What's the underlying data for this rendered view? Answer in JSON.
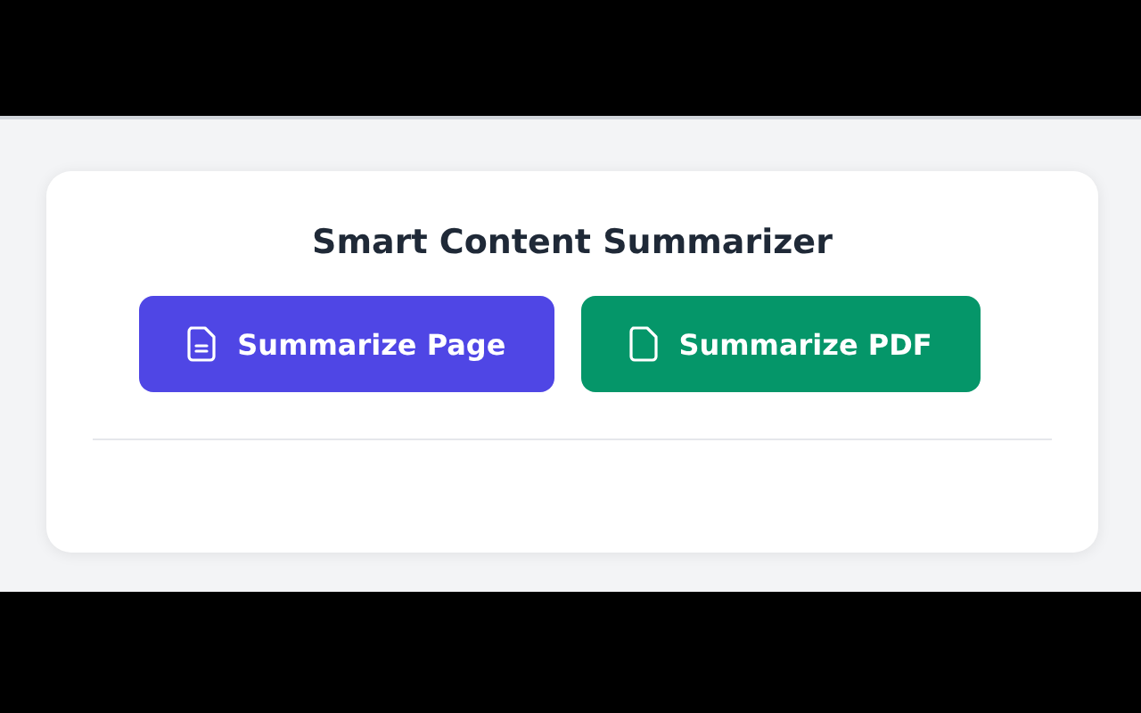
{
  "title": "Smart Content Summarizer",
  "buttons": [
    {
      "label": "Summarize Page",
      "kind": "page",
      "color": "#4f46e5"
    },
    {
      "label": "Summarize PDF",
      "kind": "pdf",
      "color": "#059669"
    }
  ]
}
